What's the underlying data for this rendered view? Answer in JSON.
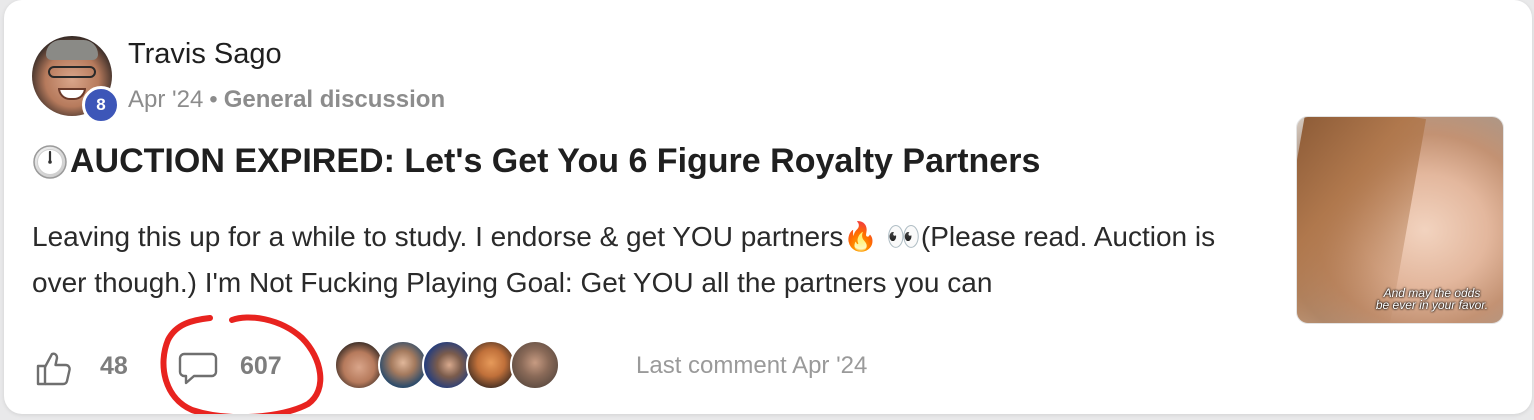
{
  "post": {
    "author": {
      "name": "Travis Sago",
      "level": "8",
      "avatar_icon": "user-avatar"
    },
    "date": "Apr '24",
    "separator": "•",
    "category": "General discussion",
    "title_icon": "timer-icon",
    "title": "AUCTION EXPIRED: Let's Get You 6 Figure Royalty Partners",
    "excerpt": "Leaving this up for a while to study. I endorse & get YOU partners🔥 👀(Please read. Auction is over though.) I'm Not Fucking Playing Goal: Get YOU all the partners you can",
    "thumbnail": {
      "caption": "And may the odds\nbe ever in your favor."
    },
    "likes": "48",
    "comments": "607",
    "commenter_avatars": [
      {
        "name": "commenter-1",
        "color": "#b67a5c"
      },
      {
        "name": "commenter-2",
        "color": "#2f4d6b"
      },
      {
        "name": "commenter-3",
        "color": "#2a3f7a"
      },
      {
        "name": "commenter-4",
        "color": "#c0703a"
      },
      {
        "name": "commenter-5",
        "color": "#5b4a40"
      }
    ],
    "last_comment": "Last comment Apr '24"
  },
  "colors": {
    "level_badge": "#3d56b8",
    "annotation_circle": "#e8231f",
    "muted_text": "#8c8c8c"
  }
}
